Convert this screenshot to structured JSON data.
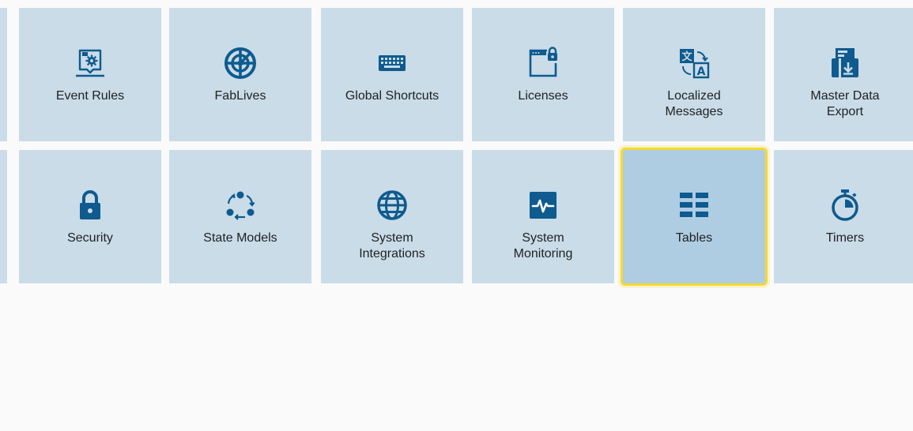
{
  "colors": {
    "tile_bg": "#c9dce8",
    "tile_selected_bg": "#aecde3",
    "icon": "#0f5a8e",
    "highlight": "#f3d931",
    "page_bg": "#fafafa"
  },
  "tiles": [
    {
      "label": "Event Rules",
      "icon": "event-rules-icon"
    },
    {
      "label": "FabLives",
      "icon": "fablives-icon"
    },
    {
      "label": "Global Shortcuts",
      "icon": "keyboard-icon"
    },
    {
      "label": "Licenses",
      "icon": "licenses-icon"
    },
    {
      "label": "Localized\nMessages",
      "icon": "translate-icon"
    },
    {
      "label": "Master Data\nExport",
      "icon": "data-export-icon"
    },
    {
      "label": "Security",
      "icon": "lock-icon"
    },
    {
      "label": "State Models",
      "icon": "state-cycle-icon"
    },
    {
      "label": "System\nIntegrations",
      "icon": "globe-icon"
    },
    {
      "label": "System\nMonitoring",
      "icon": "pulse-monitor-icon"
    },
    {
      "label": "Tables",
      "icon": "table-grid-icon",
      "selected": true
    },
    {
      "label": "Timers",
      "icon": "stopwatch-icon"
    }
  ]
}
